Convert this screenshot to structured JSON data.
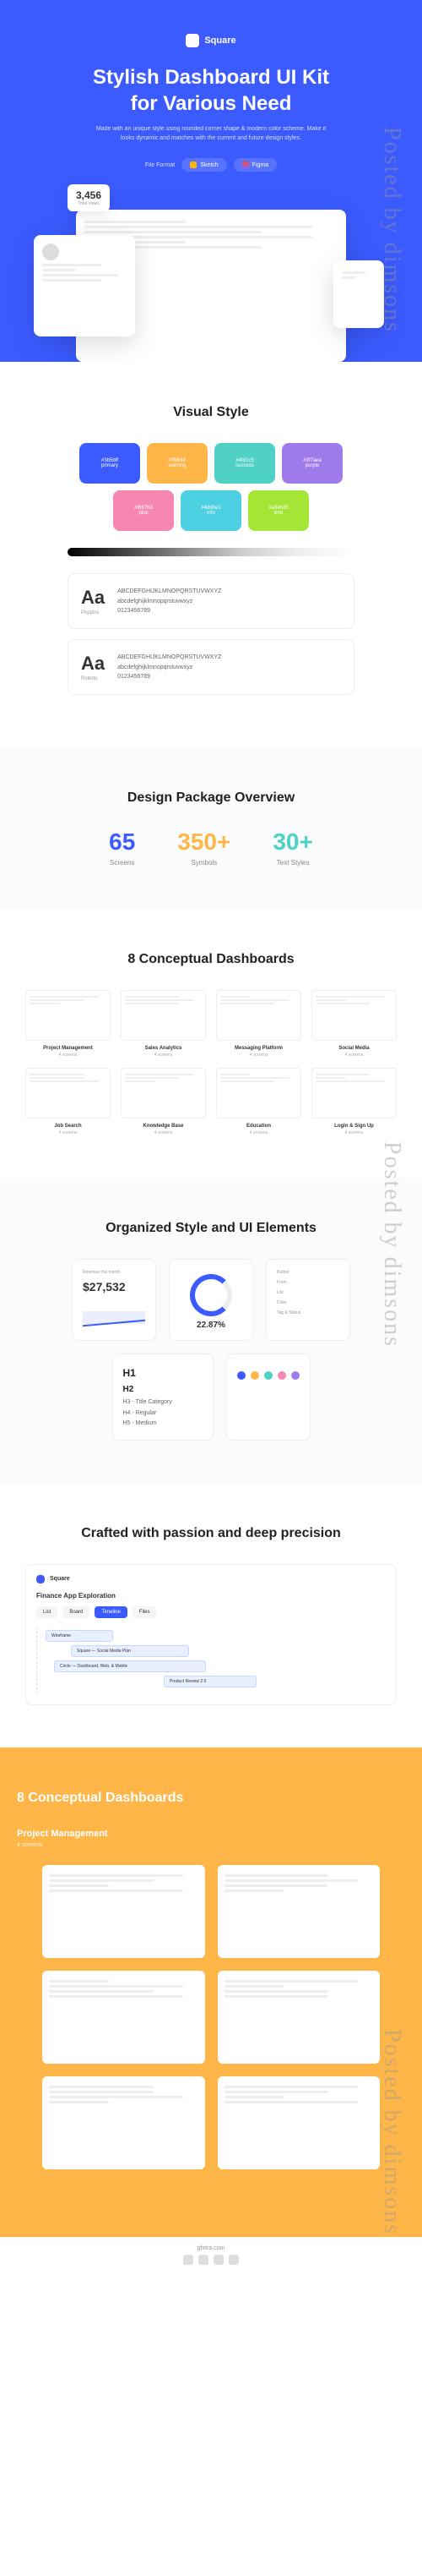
{
  "watermark": "Posted by dimsons",
  "hero": {
    "logo": "Square",
    "title_line1": "Stylish Dashboard UI Kit",
    "title_line2": "for Various Need",
    "subtitle": "Made with an unique style using rounded corner shape & modern color scheme. Make it looks dynamic and matches with the current and future design styles.",
    "format_label": "File Format",
    "format_sketch": "Sketch",
    "format_figma": "Figma",
    "stat_number": "3,456",
    "stat_label": "Total Views"
  },
  "visual_style": {
    "title": "Visual Style",
    "swatches": [
      {
        "name": "#3b5bff",
        "sub": "primary"
      },
      {
        "name": "#ffb648",
        "sub": "warning"
      },
      {
        "name": "#4fd1c5",
        "sub": "success"
      },
      {
        "name": "#9f7aea",
        "sub": "purple"
      },
      {
        "name": "#f687b3",
        "sub": "pink"
      },
      {
        "name": "#4dd0e1",
        "sub": "info"
      },
      {
        "name": "#a3e635",
        "sub": "lime"
      }
    ],
    "fonts": [
      {
        "aa": "Aa",
        "name": "Poppins",
        "upper": "ABCDEFGHIJKLMNOPQRSTUVWXYZ",
        "lower": "abcdefghijklmnopqrstuvwxyz",
        "nums": "0123456789"
      },
      {
        "aa": "Aa",
        "name": "Roboto",
        "upper": "ABCDEFGHIJKLMNOPQRSTUVWXYZ",
        "lower": "abcdefghijklmnopqrstuvwxyz",
        "nums": "0123456789"
      }
    ]
  },
  "package": {
    "title": "Design Package Overview",
    "stats": [
      {
        "num": "65",
        "label": "Screens"
      },
      {
        "num": "350+",
        "label": "Symbols"
      },
      {
        "num": "30+",
        "label": "Text Styles"
      }
    ]
  },
  "dashboards": {
    "title": "8 Conceptual Dashboards",
    "items": [
      {
        "name": "Project Management",
        "count": "4 screens"
      },
      {
        "name": "Sales Analytics",
        "count": "4 screens"
      },
      {
        "name": "Messaging Platform",
        "count": "4 screens"
      },
      {
        "name": "Social Media",
        "count": "4 screens"
      },
      {
        "name": "Job Search",
        "count": "4 screens"
      },
      {
        "name": "Knowledge Base",
        "count": "4 screens"
      },
      {
        "name": "Education",
        "count": "4 screens"
      },
      {
        "name": "Login & Sign Up",
        "count": "4 screens"
      }
    ]
  },
  "elements": {
    "title": "Organized Style and UI Elements",
    "revenue_label": "Revenue this month",
    "revenue": "$27,532",
    "progress": "22.87%",
    "labels": {
      "button": "Button",
      "form": "Form",
      "list": "List",
      "color": "Color",
      "tags": "Tag & Status"
    },
    "typography": {
      "h1": "H1",
      "h2": "H2",
      "h3": "H3 - Title Category",
      "h4": "H4 - Regular",
      "h5": "H5 - Medium"
    }
  },
  "precision": {
    "title": "Crafted with passion and deep precision",
    "brand": "Square",
    "tabs": [
      "List",
      "Board",
      "Timeline",
      "Files"
    ],
    "project": "Finance App Exploration",
    "tasks": [
      {
        "name": "Wireframe"
      },
      {
        "name": "Square — Social Media Plan"
      },
      {
        "name": "Circle — Dashboard, Web, & Mobile"
      },
      {
        "name": "Product Review 2.0"
      }
    ]
  },
  "footer": {
    "title": "8 Conceptual Dashboards",
    "category": "Project Management",
    "count": "4 screens",
    "site": "gfxtra.com"
  }
}
